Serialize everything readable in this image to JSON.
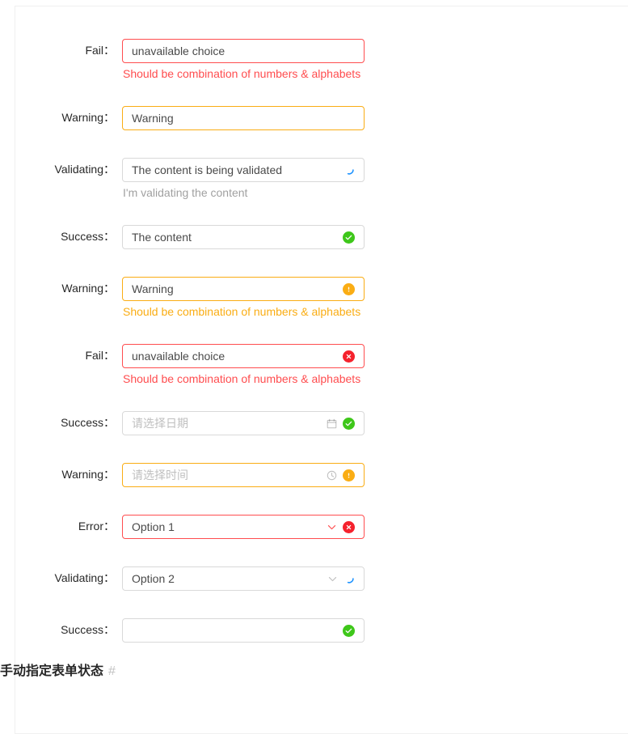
{
  "page": {
    "section_heading": "手动指定表单状态",
    "section_anchor": "#"
  },
  "colors": {
    "error": "#ff4d4f",
    "error_solid": "#f5222d",
    "warning": "#faad14",
    "success": "#52c41a",
    "border": "#d9d9d9",
    "placeholder": "#bfbfbf",
    "spinner": "#1890ff"
  },
  "form": {
    "rows": [
      {
        "label": "Fail",
        "colon": "：",
        "value": "unavailable choice",
        "is_placeholder": false,
        "status": "error",
        "help": "Should be combination of numbers & alphabets",
        "help_status": "error",
        "suffix_icons": []
      },
      {
        "label": "Warning",
        "colon": "：",
        "value": "Warning",
        "is_placeholder": false,
        "status": "warning",
        "help": "",
        "help_status": "",
        "suffix_icons": []
      },
      {
        "label": "Validating",
        "colon": "：",
        "value": "The content is being validated",
        "is_placeholder": false,
        "status": "validating",
        "help": "I'm validating the content",
        "help_status": "muted",
        "suffix_icons": [
          "loading-spinner-icon"
        ]
      },
      {
        "label": "Success",
        "colon": "：",
        "value": "The content",
        "is_placeholder": false,
        "status": "success",
        "help": "",
        "help_status": "",
        "suffix_icons": [
          "success-check-icon"
        ]
      },
      {
        "label": "Warning",
        "colon": "：",
        "value": "Warning",
        "is_placeholder": false,
        "status": "warning",
        "help": "Should be combination of numbers & alphabets",
        "help_status": "warning",
        "suffix_icons": [
          "warning-exclamation-icon"
        ]
      },
      {
        "label": "Fail",
        "colon": "：",
        "value": "unavailable choice",
        "is_placeholder": false,
        "status": "error",
        "help": "Should be combination of numbers & alphabets",
        "help_status": "error",
        "suffix_icons": [
          "error-close-icon"
        ]
      },
      {
        "label": "Success",
        "colon": "：",
        "value": "请选择日期",
        "is_placeholder": true,
        "status": "success",
        "help": "",
        "help_status": "",
        "suffix_icons": [
          "calendar-icon",
          "success-check-icon"
        ]
      },
      {
        "label": "Warning",
        "colon": "：",
        "value": "请选择时间",
        "is_placeholder": true,
        "status": "warning",
        "help": "",
        "help_status": "",
        "suffix_icons": [
          "clock-icon",
          "warning-exclamation-icon"
        ]
      },
      {
        "label": "Error",
        "colon": "：",
        "value": "Option 1",
        "is_placeholder": false,
        "status": "error",
        "help": "",
        "help_status": "",
        "suffix_icons": [
          "chevron-down-icon-error",
          "error-close-icon"
        ]
      },
      {
        "label": "Validating",
        "colon": "：",
        "value": "Option 2",
        "is_placeholder": false,
        "status": "validating",
        "help": "",
        "help_status": "",
        "suffix_icons": [
          "chevron-down-icon",
          "loading-spinner-icon"
        ]
      },
      {
        "label": "Success",
        "colon": "：",
        "value": "",
        "is_placeholder": false,
        "status": "success",
        "help": "",
        "help_status": "",
        "suffix_icons": [
          "success-check-icon"
        ]
      }
    ]
  }
}
